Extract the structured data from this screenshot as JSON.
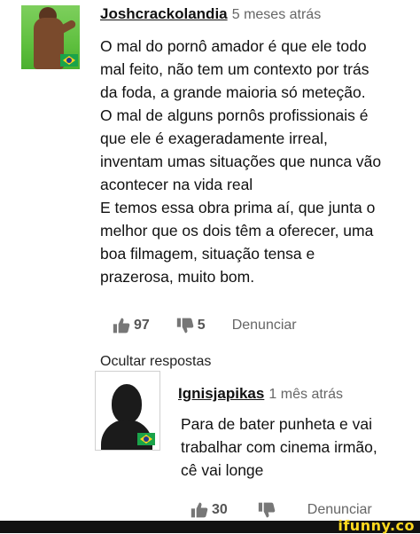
{
  "comment": {
    "username": "Joshcrackolandia",
    "timestamp": "5 meses atrás",
    "lines": [
      "O mal do pornô amador é que ele todo",
      "mal feito, não tem um contexto por trás",
      "da foda, a grande maioria só meteção.",
      "O mal de alguns pornôs profissionais é",
      "que ele é exageradamente irreal,",
      "inventam umas situações que nunca vão",
      "acontecer na vida real",
      "E temos essa obra prima aí, que junta o",
      "melhor que os dois têm a oferecer, uma",
      "boa filmagem, situação tensa e",
      "prazerosa, muito bom."
    ],
    "likes": "97",
    "dislikes": "5",
    "report_label": "Denunciar",
    "hide_replies_label": "Ocultar respostas"
  },
  "reply": {
    "username": "Ignisjapikas",
    "timestamp": "1 mês atrás",
    "lines": [
      "Para de bater punheta e vai",
      "trabalhar com cinema irmão,",
      "cê vai longe"
    ],
    "likes": "30",
    "report_label": "Denunciar"
  },
  "watermark": {
    "text": "ifunny.co",
    "color": "#ffd91f"
  },
  "icons": {
    "like": "thumbs-up-icon",
    "dislike": "thumbs-down-icon",
    "flag": "brazil-flag-icon"
  },
  "colors": {
    "text": "#111111",
    "muted": "#666666",
    "avatar_bg": "#5fc03f"
  }
}
